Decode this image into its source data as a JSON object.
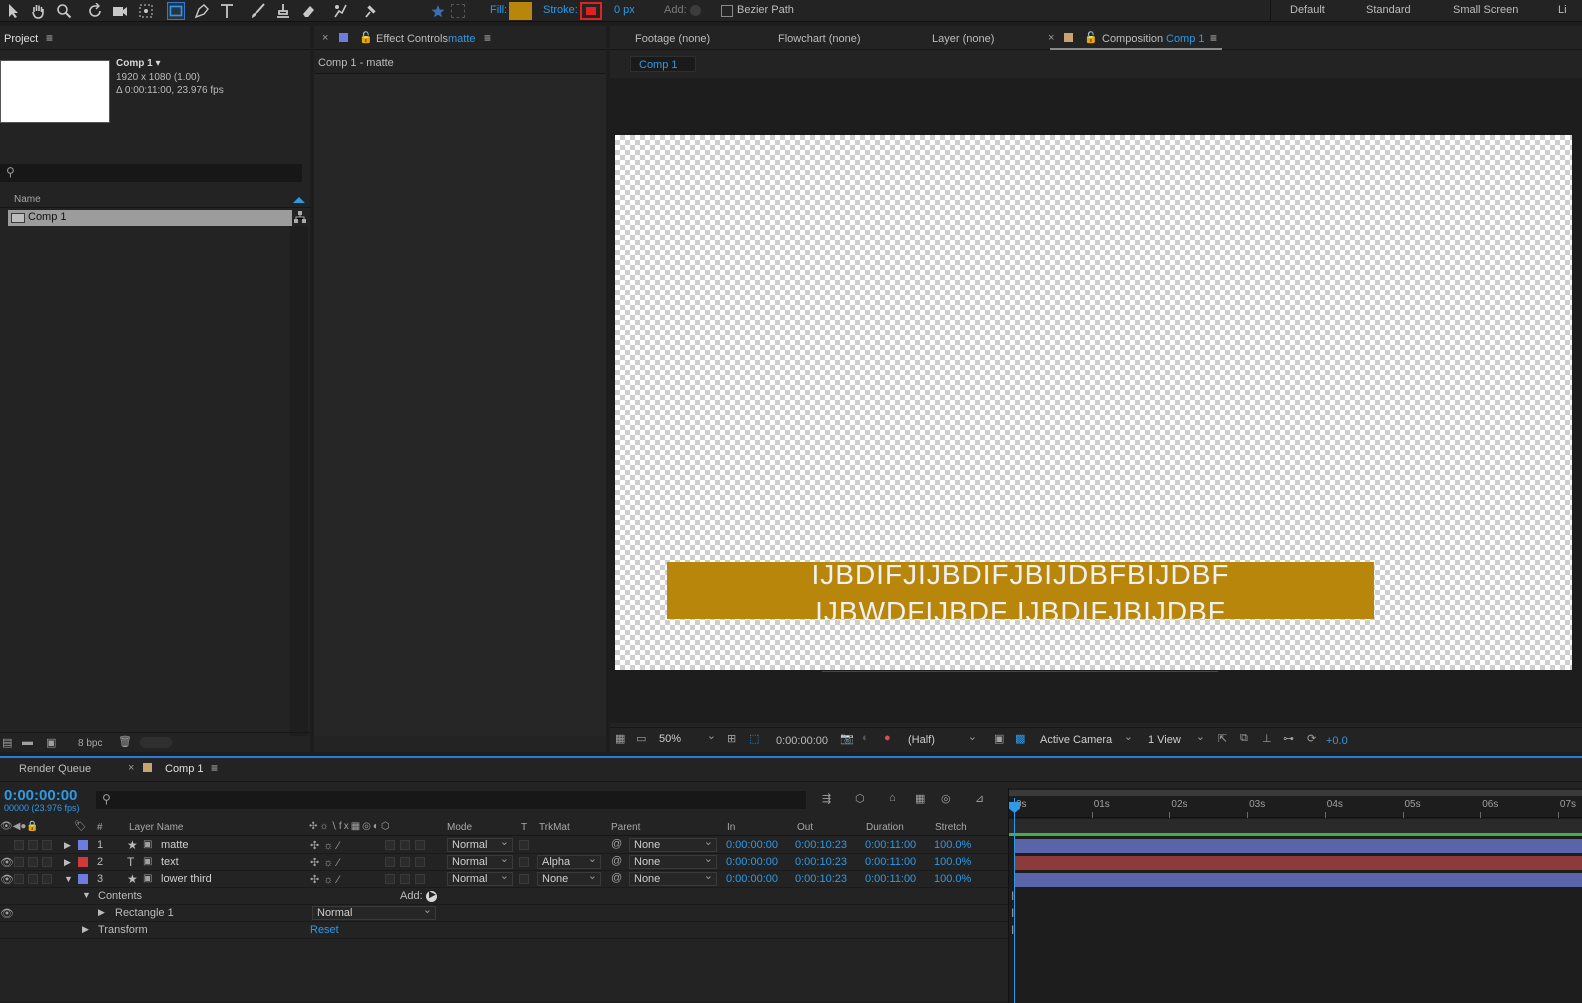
{
  "toolbar": {
    "fill_label": "Fill:",
    "fill_color": "#b8860b",
    "stroke_label": "Stroke:",
    "stroke_color": "#e32121",
    "stroke_width": "0 px",
    "add_label": "Add:",
    "bezier_label": "Bezier Path",
    "workspaces": [
      "Default",
      "Standard",
      "Small Screen",
      "Li"
    ]
  },
  "project": {
    "tab": "Project",
    "item_name": "Comp 1 ▾",
    "item_size": "1920 x 1080 (1.00)",
    "item_duration": "Δ 0:00:11:00, 23.976 fps",
    "col_name": "Name",
    "rows": [
      "Comp 1"
    ],
    "bpc": "8 bpc"
  },
  "effect_controls": {
    "tab_prefix": "Effect Controls",
    "tab_layer": "matte",
    "subtitle": "Comp 1 - matte"
  },
  "viewer": {
    "tabs": [
      "Footage (none)",
      "Flowchart (none)",
      "Layer (none)"
    ],
    "comp_tab_prefix": "Composition",
    "comp_tab_name": "Comp 1",
    "breadcrumb": "Comp 1",
    "bar_color": "#b8860b",
    "text_line1": "IJBDIFJIJBDIFJBIJDBFBIJDBF",
    "text_line2": "IJBWDFIJBDF  IJBDIFJBIJDBF",
    "zoom": "50%",
    "timecode": "0:00:00:00",
    "resolution": "(Half)",
    "camera": "Active Camera",
    "views": "1 View",
    "exposure": "+0.0"
  },
  "timeline": {
    "tab_render": "Render Queue",
    "tab_comp": "Comp 1",
    "timecode": "0:00:00:00",
    "frames": "00000 (23.976 fps)",
    "columns": {
      "num": "#",
      "layer_name": "Layer Name",
      "mode": "Mode",
      "t": "T",
      "trkmat": "TrkMat",
      "parent": "Parent",
      "in": "In",
      "out": "Out",
      "duration": "Duration",
      "stretch": "Stretch"
    },
    "ruler": [
      "0s",
      "01s",
      "02s",
      "03s",
      "04s",
      "05s",
      "06s",
      "07s"
    ],
    "layers": [
      {
        "num": "1",
        "name": "matte",
        "icon": "shape-star-icon",
        "color": "#6e7ce0",
        "mode": "Normal",
        "trkmat": "",
        "parent": "None",
        "in": "0:00:00:00",
        "out": "0:00:10:23",
        "duration": "0:00:11:00",
        "stretch": "100.0%",
        "bar_color": "#5a64a8",
        "expanded": false
      },
      {
        "num": "2",
        "name": "text",
        "icon": "text-T-icon",
        "color": "#d03a3a",
        "mode": "Normal",
        "trkmat": "Alpha",
        "parent": "None",
        "in": "0:00:00:00",
        "out": "0:00:10:23",
        "duration": "0:00:11:00",
        "stretch": "100.0%",
        "bar_color": "#8c3a3a",
        "expanded": false
      },
      {
        "num": "3",
        "name": "lower third",
        "icon": "shape-star-icon",
        "color": "#6e7ce0",
        "mode": "Normal",
        "trkmat": "None",
        "parent": "None",
        "in": "0:00:00:00",
        "out": "0:00:10:23",
        "duration": "0:00:11:00",
        "stretch": "100.0%",
        "bar_color": "#5a64a8",
        "expanded": true
      }
    ],
    "contents_label": "Contents",
    "add_label": "Add:",
    "rect_label": "Rectangle 1",
    "rect_mode": "Normal",
    "transform_label": "Transform",
    "reset_label": "Reset"
  }
}
